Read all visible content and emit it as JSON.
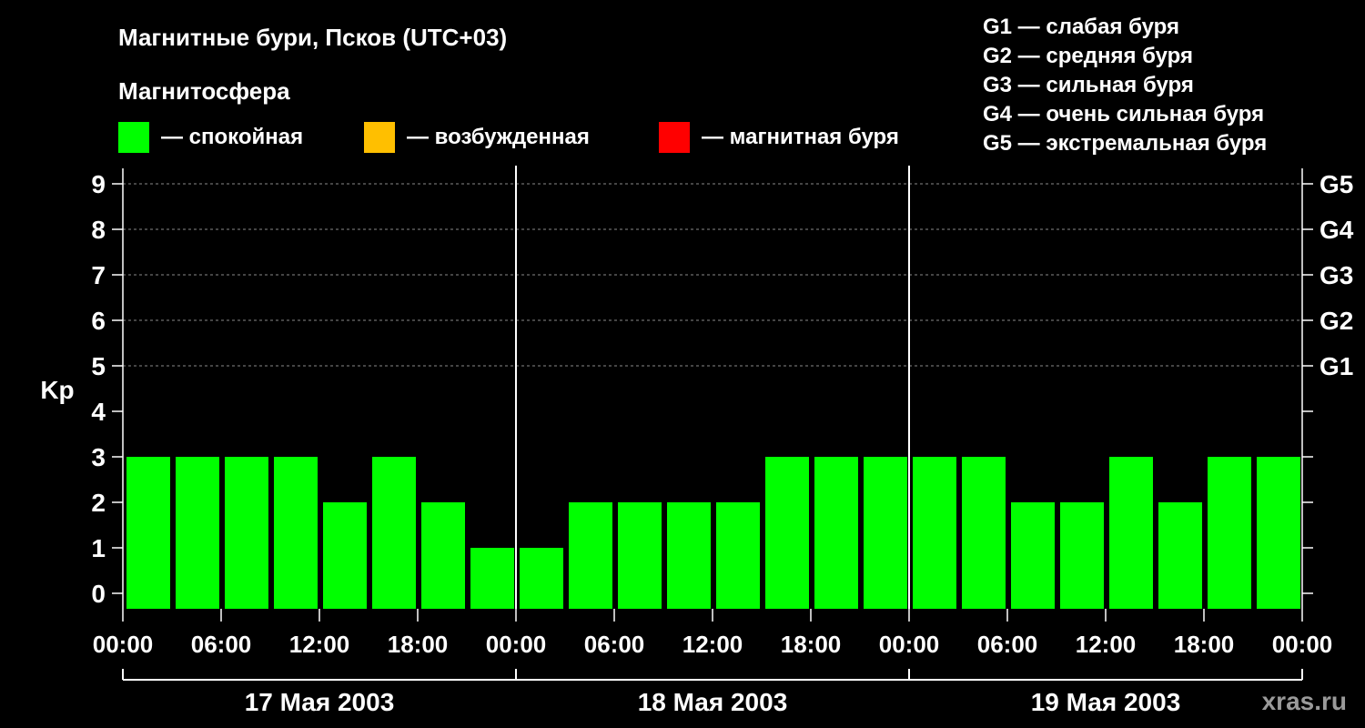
{
  "title": "Магнитные бури, Псков (UTC+03)",
  "legend": {
    "heading": "Магнитосфера",
    "items": [
      {
        "label": "— спокойная",
        "color": "#00ff00"
      },
      {
        "label": "— возбужденная",
        "color": "#ffbf00"
      },
      {
        "label": "— магнитная буря",
        "color": "#ff0000"
      }
    ]
  },
  "storm_scale": [
    "G1 — слабая буря",
    "G2 — средняя буря",
    "G3 — сильная буря",
    "G4 — очень сильная буря",
    "G5 — экстремальная буря"
  ],
  "watermark": "xras.ru",
  "chart_data": {
    "type": "bar",
    "ylabel": "Kp",
    "ylim": [
      0,
      9
    ],
    "yticks": [
      "0",
      "1",
      "2",
      "3",
      "4",
      "5",
      "6",
      "7",
      "8",
      "9"
    ],
    "right_axis_labels": [
      {
        "value": 5,
        "label": "G1"
      },
      {
        "value": 6,
        "label": "G2"
      },
      {
        "value": 7,
        "label": "G3"
      },
      {
        "value": 8,
        "label": "G4"
      },
      {
        "value": 9,
        "label": "G5"
      }
    ],
    "xtick_labels": [
      "00:00",
      "06:00",
      "12:00",
      "18:00",
      "00:00",
      "06:00",
      "12:00",
      "18:00",
      "00:00",
      "06:00",
      "12:00",
      "18:00",
      "00:00"
    ],
    "days": [
      "17 Мая 2003",
      "18 Мая 2003",
      "19 Мая 2003"
    ],
    "interval_hours": 3,
    "values": [
      3,
      3,
      3,
      3,
      2,
      3,
      2,
      1,
      1,
      2,
      2,
      2,
      2,
      3,
      3,
      3,
      3,
      3,
      2,
      2,
      3,
      2,
      3,
      3
    ],
    "bar_color": "#00ff00",
    "grid": "dashed at Kp 5–9"
  }
}
